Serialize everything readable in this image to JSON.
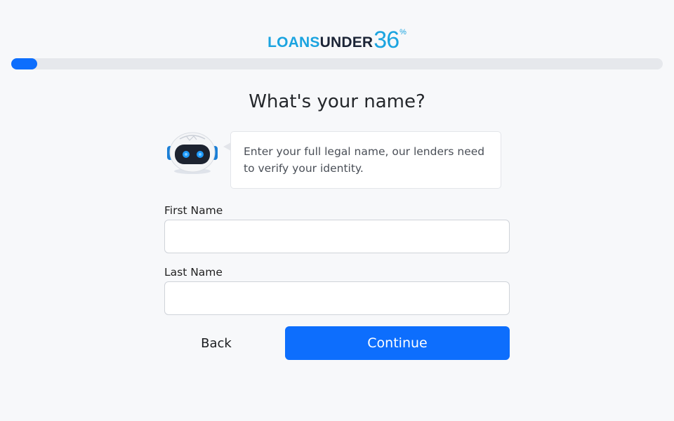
{
  "brand": {
    "logo_part1": "LOANS",
    "logo_part2": "UNDER",
    "logo_number": "36",
    "logo_percent": "%",
    "primary_color": "#1ba4e0",
    "dark_color": "#1c2537"
  },
  "progress": {
    "fraction": 0.04,
    "fill_color": "#0d6efd"
  },
  "main": {
    "heading": "What's your name?",
    "assistant_message": "Enter your full legal name, our lenders need to verify your identity.",
    "assistant_icon": "robot-avatar-icon"
  },
  "form": {
    "first_name_label": "First Name",
    "first_name_value": "",
    "last_name_label": "Last Name",
    "last_name_value": ""
  },
  "actions": {
    "back_label": "Back",
    "continue_label": "Continue",
    "continue_color": "#0d6efd"
  }
}
